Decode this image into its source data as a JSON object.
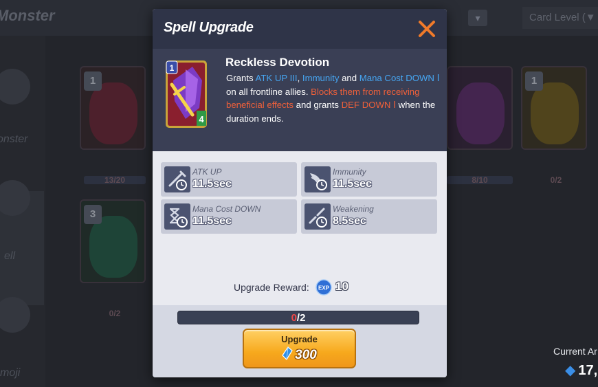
{
  "background": {
    "title": "Monster",
    "sort_label": "Card Level (▼",
    "sidebar": [
      "onster",
      "ell",
      "moji"
    ],
    "card_levels": [
      "1",
      "1",
      "3"
    ],
    "card_counts": [
      "13/20",
      "8/10",
      "0/2",
      "0/2"
    ],
    "currency": {
      "label": "Current Ar",
      "value": "17,"
    }
  },
  "modal": {
    "title": "Spell Upgrade",
    "close_icon": "close-x-icon",
    "card": {
      "level": "1",
      "cost": "4"
    },
    "spell_name": "Reckless Devotion",
    "description": {
      "p1": "Grants ",
      "atk": "ATK UP III",
      "p2": ", ",
      "immunity": "Immunity",
      "p3": " and ",
      "mana": "Mana Cost DOWN Ⅰ",
      "p4": " on all frontline allies. ",
      "block": "Blocks them from receiving beneficial effects",
      "p5": " and grants ",
      "def": "DEF DOWN Ⅰ",
      "p6": " when the duration ends."
    },
    "effects": [
      {
        "name": "ATK UP",
        "value": "11.5sec",
        "icon": "sword-timer-icon"
      },
      {
        "name": "Immunity",
        "value": "11.5sec",
        "icon": "wing-timer-icon"
      },
      {
        "name": "Mana Cost DOWN",
        "value": "11.5sec",
        "icon": "hourglass-timer-icon"
      },
      {
        "name": "Weakening",
        "value": "8.5sec",
        "icon": "broken-sword-timer-icon"
      }
    ],
    "reward": {
      "label": "Upgrade Reward:",
      "value": "10",
      "icon": "exp-icon"
    },
    "progress": {
      "current": "0",
      "total": "/2",
      "fraction": 0
    },
    "upgrade": {
      "label": "Upgrade",
      "cost": "300",
      "icon": "crystal-icon"
    }
  },
  "colors": {
    "accent_blue": "#46a6f2",
    "accent_red": "#f0603a",
    "close_orange": "#f07a2a",
    "button_orange": "#f7a91d"
  }
}
